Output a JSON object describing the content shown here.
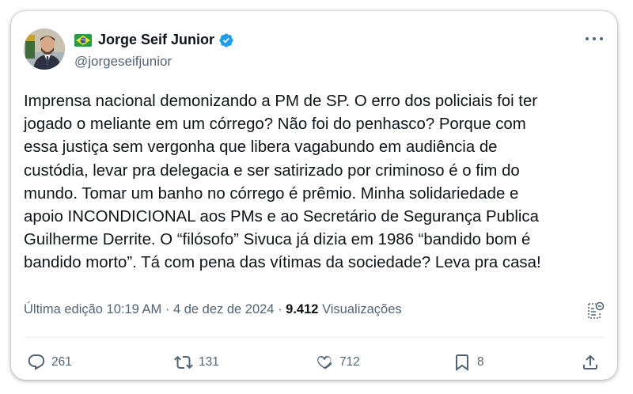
{
  "author": {
    "name": "Jorge Seif Junior",
    "handle": "@jorgeseifjunior",
    "flag_icon": "brazil-flag-icon",
    "verified_icon": "verified-badge-icon",
    "verified_color": "#1d9bf0"
  },
  "tweet": {
    "text": "Imprensa nacional demonizando a PM de SP. O erro dos policiais foi ter\njogado o meliante em um córrego? Não foi do penhasco? Porque com\nessa justiça sem vergonha que libera vagabundo em audiência de\ncustódia, levar pra delegacia e ser satirizado por criminoso é o fim do\nmundo. Tomar um banho no córrego é prêmio. Minha solidariedade e\napoio INCONDICIONAL aos PMs e ao Secretário de Segurança Publica\nGuilherme Derrite. O “filósofo” Sivuca já dizia em 1986 “bandido bom é\nbandido morto”. Tá com pena das vítimas da sociedade? Leva pra casa!"
  },
  "meta": {
    "edit_label": "Última edição 10:19 AM",
    "separator": "·",
    "date": "4 de dez de 2024",
    "views_count": "9.412",
    "views_label": "Visualizações"
  },
  "actions": {
    "replies": "261",
    "reposts": "131",
    "likes": "712",
    "bookmarks": "8"
  },
  "colors": {
    "text": "#0f1419",
    "secondary": "#536471",
    "accent": "#1d9bf0"
  }
}
